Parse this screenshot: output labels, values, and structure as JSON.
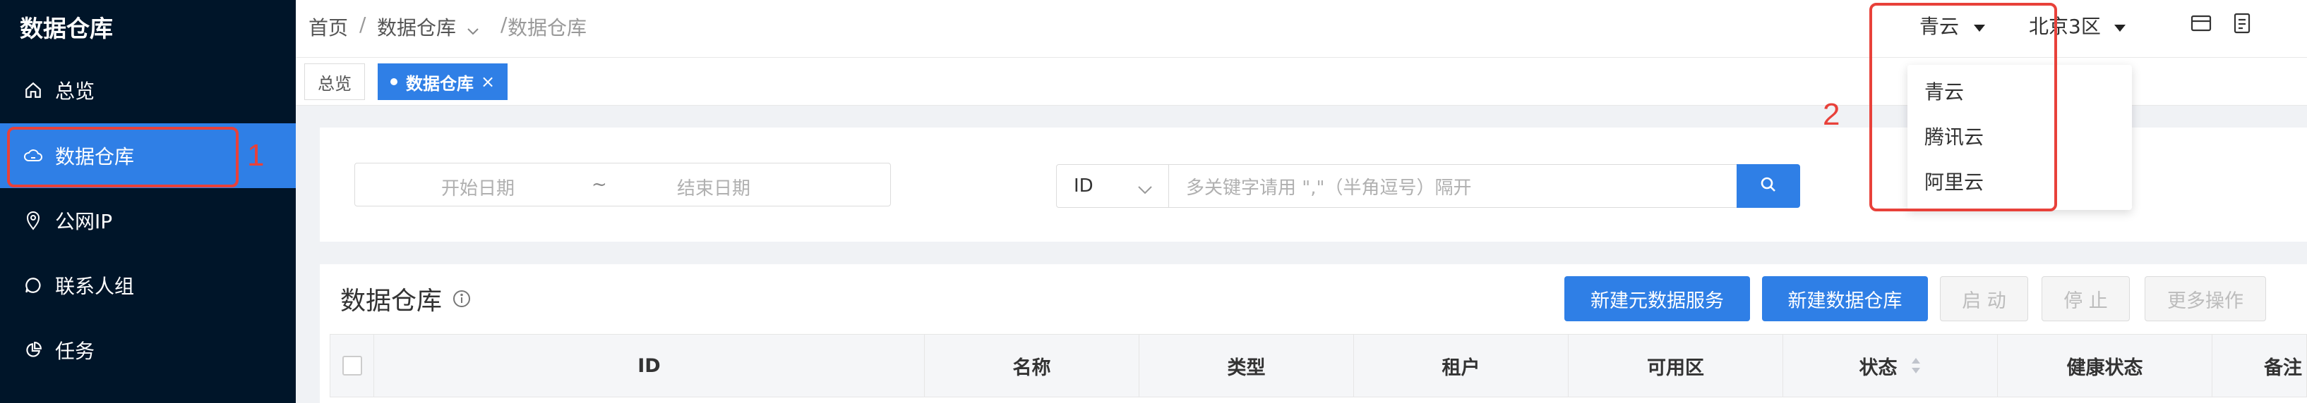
{
  "app": {
    "title": "数据仓库"
  },
  "sidebar": {
    "items": [
      {
        "label": "总览",
        "icon": "home-icon"
      },
      {
        "label": "数据仓库",
        "icon": "cloud-icon",
        "active": true
      },
      {
        "label": "公网IP",
        "icon": "location-pin-icon"
      },
      {
        "label": "联系人组",
        "icon": "chat-icon"
      },
      {
        "label": "任务",
        "icon": "pie-chart-icon"
      }
    ]
  },
  "breadcrumb": {
    "home": "首页",
    "sep": "/",
    "mid": "数据仓库",
    "last": "数据仓库"
  },
  "topbar": {
    "cloud": "青云",
    "region": "北京3区"
  },
  "tabs": [
    {
      "label": "总览"
    },
    {
      "label": "数据仓库",
      "close": "×"
    }
  ],
  "filter": {
    "start_placeholder": "开始日期",
    "tilde": "~",
    "end_placeholder": "结束日期",
    "select_value": "ID",
    "keyword_placeholder": "多关键字请用 \",\"（半角逗号）隔开"
  },
  "section": {
    "title": "数据仓库"
  },
  "actions": {
    "new_meta": "新建元数据服务",
    "new_warehouse": "新建数据仓库",
    "start": "启 动",
    "stop": "停 止",
    "more": "更多操作"
  },
  "table": {
    "headers": [
      "ID",
      "名称",
      "类型",
      "租户",
      "可用区",
      "状态",
      "健康状态",
      "备注"
    ]
  },
  "dropdown": {
    "items": [
      "青云",
      "腾讯云",
      "阿里云"
    ]
  },
  "annotations": {
    "one": "1",
    "two": "2"
  },
  "colors": {
    "sidebar_bg": "#001529",
    "accent": "#2f7fe6",
    "annotation": "#e8413a"
  }
}
